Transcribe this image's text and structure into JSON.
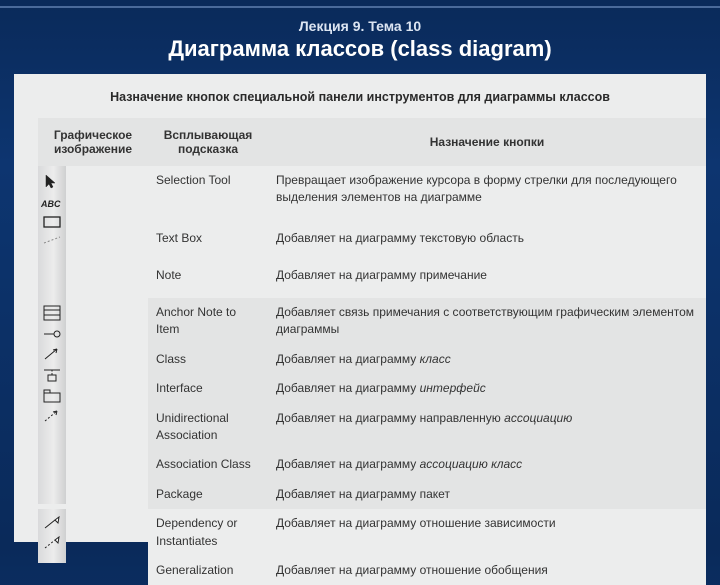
{
  "header": {
    "lecture": "Лекция 9. Тема 10",
    "title": "Диаграмма классов (class diagram)"
  },
  "table": {
    "caption": "Назначение кнопок специальной панели инструментов для диаграммы классов",
    "columns": {
      "graphic": "Графическое изображение",
      "tooltip": "Всплывающая подсказка",
      "purpose": "Назначение кнопки"
    },
    "rows": [
      {
        "tooltip": "Selection Tool",
        "purpose_prefix": "Превращает изображение курсора в форму стрелки для последующего выделения элементов на диаграмме",
        "purpose_italic": ""
      },
      {
        "tooltip": "Text Box",
        "purpose_prefix": "Добавляет на диаграмму текстовую область",
        "purpose_italic": ""
      },
      {
        "tooltip": "Note",
        "purpose_prefix": "Добавляет на диаграмму примечание",
        "purpose_italic": ""
      },
      {
        "tooltip": "Anchor Note to Item",
        "purpose_prefix": "Добавляет связь примечания с соответствующим графическим элементом диаграммы",
        "purpose_italic": ""
      },
      {
        "tooltip": "Class",
        "purpose_prefix": "Добавляет на диаграмму ",
        "purpose_italic": "класс"
      },
      {
        "tooltip": "Interface",
        "purpose_prefix": "Добавляет на диаграмму ",
        "purpose_italic": "интерфейс"
      },
      {
        "tooltip": "Unidirectional Association",
        "purpose_prefix": "Добавляет на диаграмму направленную ",
        "purpose_italic": "ассоциацию"
      },
      {
        "tooltip": "Association Class",
        "purpose_prefix": "Добавляет на диаграмму ",
        "purpose_italic": "ассоциацию класс"
      },
      {
        "tooltip": "Package",
        "purpose_prefix": "Добавляет на диаграмму пакет",
        "purpose_italic": ""
      },
      {
        "tooltip": "Dependency or Instantiates",
        "purpose_prefix": "Добавляет на диаграмму отношение зависимости",
        "purpose_italic": ""
      },
      {
        "tooltip": "Generalization",
        "purpose_prefix": "Добавляет на диаграмму отношение обобщения",
        "purpose_italic": ""
      }
    ]
  }
}
